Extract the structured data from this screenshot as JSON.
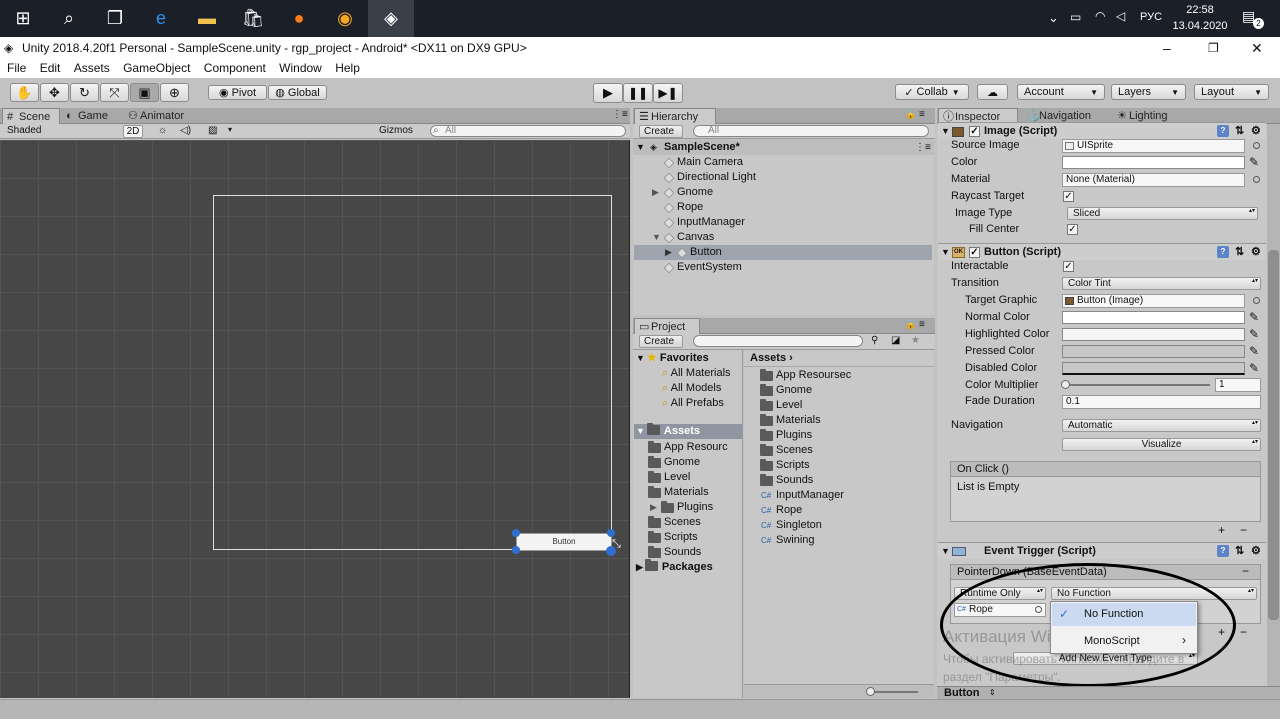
{
  "taskbar": {
    "time": "22:58",
    "date": "13.04.2020",
    "lang": "РУС",
    "notifications": "2"
  },
  "window": {
    "title": "Unity 2018.4.20f1 Personal - SampleScene.unity - rgp_project - Android* <DX11 on DX9 GPU>"
  },
  "menu": [
    "File",
    "Edit",
    "Assets",
    "GameObject",
    "Component",
    "Window",
    "Help"
  ],
  "toolbar": {
    "pivot": "Pivot",
    "global": "Global",
    "collab": "Collab",
    "account": "Account",
    "layers": "Layers",
    "layout": "Layout"
  },
  "scene": {
    "tabs": [
      "Scene",
      "Game",
      "Animator"
    ],
    "shading": "Shaded",
    "mode2d": "2D",
    "gizmos": "Gizmos",
    "search": "All",
    "button_label": "Button"
  },
  "hierarchy": {
    "tab": "Hierarchy",
    "create": "Create",
    "search": "All",
    "scene": "SampleScene*",
    "items": [
      "Main Camera",
      "Directional Light",
      "Gnome",
      "Rope",
      "InputManager",
      "Canvas",
      "Button",
      "EventSystem"
    ]
  },
  "project": {
    "tab": "Project",
    "create": "Create",
    "favorites": "Favorites",
    "fav_items": [
      "All Materials",
      "All Models",
      "All Prefabs"
    ],
    "assets": "Assets",
    "tree_items": [
      "App Resourc",
      "Gnome",
      "Level",
      "Materials",
      "Plugins",
      "Scenes",
      "Scripts",
      "Sounds"
    ],
    "packages": "Packages",
    "breadcrumb": "Assets",
    "list": [
      "App Resoursec",
      "Gnome",
      "Level",
      "Materials",
      "Plugins",
      "Scenes",
      "Scripts",
      "Sounds",
      "InputManager",
      "Rope",
      "Singleton",
      "Swining"
    ]
  },
  "inspector": {
    "tabs": [
      "Inspector",
      "Navigation",
      "Lighting"
    ],
    "image": {
      "title": "Image (Script)",
      "source_label": "Source Image",
      "source": "UISprite",
      "color_label": "Color",
      "material_label": "Material",
      "material": "None (Material)",
      "raycast_label": "Raycast Target",
      "type_label": "Image Type",
      "type": "Sliced",
      "fill_label": "Fill Center"
    },
    "button": {
      "title": "Button (Script)",
      "interactable": "Interactable",
      "transition_label": "Transition",
      "transition": "Color Tint",
      "target_label": "Target Graphic",
      "target": "Button (Image)",
      "normal": "Normal Color",
      "highlighted": "Highlighted Color",
      "pressed": "Pressed Color",
      "disabled": "Disabled Color",
      "multiplier_label": "Color Multiplier",
      "multiplier": "1",
      "fade_label": "Fade Duration",
      "fade": "0.1",
      "nav_label": "Navigation",
      "nav": "Automatic",
      "visualize": "Visualize",
      "onclick": "On Click ()",
      "empty": "List is Empty"
    },
    "trigger": {
      "title": "Event Trigger (Script)",
      "event": "PointerDown (BaseEventData)",
      "runtime": "Runtime Only",
      "function": "No Function",
      "object": "Rope",
      "add_event": "Add New Event Type"
    },
    "dropdown": [
      "No Function",
      "MonoScript"
    ],
    "watermark1": "Активация Windows",
    "watermark2": "Чтобы активировать Windows, перейдите в",
    "watermark3": "раздел \"Параметры\".",
    "footer": "Button"
  }
}
